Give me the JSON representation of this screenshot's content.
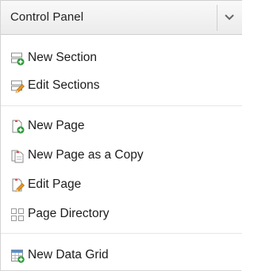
{
  "header": {
    "title": "Control Panel",
    "toggle_icon": "chevron-down-icon"
  },
  "menu": {
    "sections": [
      {
        "items": [
          {
            "label": "New Section",
            "icon": "new-section-icon"
          },
          {
            "label": "Edit Sections",
            "icon": "edit-sections-icon"
          }
        ]
      },
      {
        "items": [
          {
            "label": "New Page",
            "icon": "new-page-icon"
          },
          {
            "label": "New Page as a Copy",
            "icon": "copy-page-icon"
          },
          {
            "label": "Edit Page",
            "icon": "edit-page-icon"
          },
          {
            "label": "Page Directory",
            "icon": "page-directory-icon"
          }
        ]
      },
      {
        "items": [
          {
            "label": "New Data Grid",
            "icon": "data-grid-icon"
          }
        ]
      }
    ]
  },
  "colors": {
    "header_bg": "#eeeeee",
    "plus_green": "#2e9a3a",
    "pencil_orange": "#e8951e"
  }
}
